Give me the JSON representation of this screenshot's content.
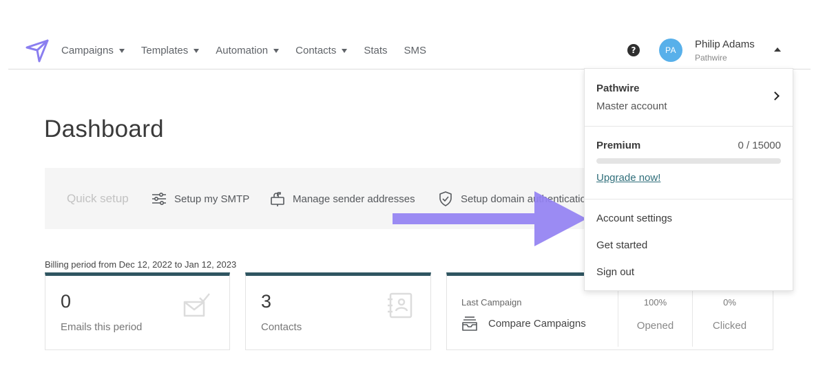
{
  "nav": {
    "items": [
      {
        "label": "Campaigns",
        "has_caret": true
      },
      {
        "label": "Templates",
        "has_caret": true
      },
      {
        "label": "Automation",
        "has_caret": true
      },
      {
        "label": "Contacts",
        "has_caret": true
      },
      {
        "label": "Stats",
        "has_caret": false
      },
      {
        "label": "SMS",
        "has_caret": false
      }
    ],
    "help_icon": "question-circle-icon"
  },
  "user": {
    "initials": "PA",
    "name": "Philip Adams",
    "organization": "Pathwire",
    "avatar_color": "#58b0ea"
  },
  "page": {
    "title": "Dashboard"
  },
  "quick_setup": {
    "label": "Quick setup",
    "items": [
      {
        "label": "Setup my SMTP",
        "icon": "sliders-icon"
      },
      {
        "label": "Manage sender addresses",
        "icon": "mailbox-icon"
      },
      {
        "label": "Setup domain authentication",
        "icon": "shield-check-icon"
      }
    ]
  },
  "billing": {
    "text": "Billing period from Dec 12, 2022 to Jan 12, 2023"
  },
  "cards": {
    "emails": {
      "value": "0",
      "label": "Emails this period",
      "icon": "envelope-check-icon"
    },
    "contacts": {
      "value": "3",
      "label": "Contacts",
      "icon": "address-book-icon"
    },
    "last_campaign": {
      "label": "Last Campaign",
      "compare_label": "Compare Campaigns",
      "compare_icon": "inbox-stack-icon",
      "opened_pct": "100%",
      "opened_label": "Opened",
      "clicked_pct": "0%",
      "clicked_label": "Clicked"
    }
  },
  "dropdown": {
    "account_name": "Pathwire",
    "account_type": "Master account",
    "plan": "Premium",
    "usage": "0 / 15000",
    "usage_fraction": 0,
    "upgrade_label": "Upgrade now!",
    "links": [
      "Account settings",
      "Get started",
      "Sign out"
    ]
  },
  "colors": {
    "brand_purple": "#8a7ef0",
    "card_accent": "#2f5561",
    "annotation_arrow": "#9381f2"
  }
}
